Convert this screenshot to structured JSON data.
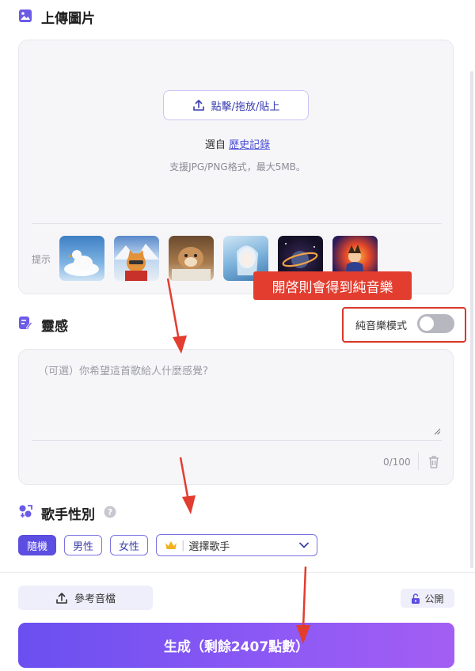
{
  "upload": {
    "title": "上傳圖片",
    "button_label": "點擊/拖放/貼上",
    "select_prefix": "選自",
    "history_link": "歷史記錄",
    "support_text": "支援JPG/PNG格式，最大5MB。",
    "hint_label": "提示",
    "thumbnails": [
      "duck-cloud",
      "cat-mountain",
      "dog-blanket",
      "girl-ice",
      "planet-ring",
      "boy-fire"
    ]
  },
  "annotation": {
    "banner_text": "開啓則會得到純音樂",
    "accent_red": "#e23d2f"
  },
  "inspiration": {
    "title": "靈感",
    "instrumental_label": "純音樂模式",
    "instrumental_on": false,
    "placeholder": "（可選）你希望這首歌給人什麼感覺?",
    "counter": "0/100"
  },
  "singer": {
    "title": "歌手性別",
    "options": [
      "隨機",
      "男性",
      "女性"
    ],
    "selected": "隨機",
    "select_placeholder": "選擇歌手"
  },
  "footer": {
    "reference_audio": "參考音檔",
    "visibility": "公開",
    "generate_label": "生成（剩餘2407點數）"
  },
  "colors": {
    "accent": "#5b4ee0",
    "gradient_start": "#6a4ff0",
    "gradient_end": "#a35ef3"
  }
}
